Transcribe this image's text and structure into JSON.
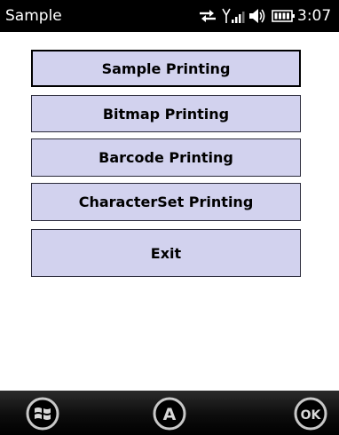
{
  "status_bar": {
    "title": "Sample",
    "time": "3:07",
    "icons": [
      "connectivity-icon",
      "signal-icon",
      "volume-icon",
      "battery-icon"
    ]
  },
  "menu": {
    "items": [
      {
        "label": "Sample Printing",
        "focused": true
      },
      {
        "label": "Bitmap Printing"
      },
      {
        "label": "Barcode Printing"
      },
      {
        "label": "CharacterSet Printing"
      },
      {
        "label": "Exit"
      }
    ]
  },
  "softkeys": {
    "left_icon": "windows-start-icon",
    "center_label": "A",
    "right_label": "OK"
  },
  "colors": {
    "button_background": "#d2d2ee",
    "button_border": "#2a2a3a",
    "status_bar": "#000000",
    "softkey_circle": "#c8c8c8"
  }
}
